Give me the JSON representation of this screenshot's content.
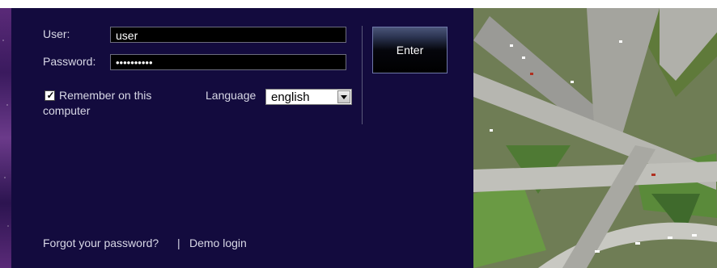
{
  "login": {
    "user_label": "User:",
    "user_value": "user",
    "password_label": "Password:",
    "password_value": "••••••••••",
    "enter_label": "Enter",
    "remember_label_line1": "Remember on this",
    "remember_label_line2": "computer",
    "remember_checked": true,
    "language_label": "Language",
    "language_value": "english",
    "forgot_label": "Forgot your password?",
    "separator": "|",
    "demo_label": "Demo login"
  },
  "images": {
    "side": "purple starry decorative strip",
    "hero": "aerial photo of highway interchange"
  },
  "colors": {
    "panel_bg": "#130b3e",
    "text": "#d8d8e6"
  }
}
